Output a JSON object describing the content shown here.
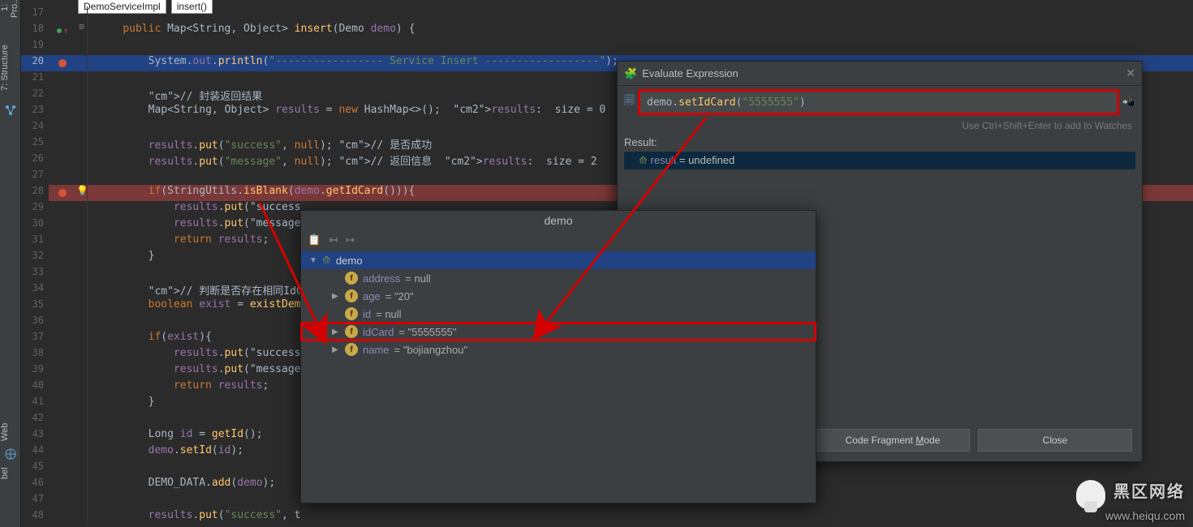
{
  "tabs": {
    "file": "DemoServiceImpl",
    "method": "insert()"
  },
  "left_sidebar": {
    "project": "1: Pro...",
    "structure": "7: Structure",
    "web": "Web",
    "bel": "bel"
  },
  "code": [
    {
      "n": 17,
      "t": ""
    },
    {
      "n": 18,
      "t": "    public Map<String, Object> insert(Demo demo) {",
      "marks": "green-up",
      "fold": "⊟"
    },
    {
      "n": 19,
      "t": ""
    },
    {
      "n": 20,
      "t": "        System.out.println(\"----------------- Service Insert ------------------\");",
      "hl": "blue",
      "marks": "red"
    },
    {
      "n": 21,
      "t": ""
    },
    {
      "n": 22,
      "t": "        // 封装返回结果"
    },
    {
      "n": 23,
      "t": "        Map<String, Object> results = new HashMap<>();  results:  size = 0"
    },
    {
      "n": 24,
      "t": ""
    },
    {
      "n": 25,
      "t": "        results.put(\"success\", null); // 是否成功"
    },
    {
      "n": 26,
      "t": "        results.put(\"message\", null); // 返回信息  results:  size = 2"
    },
    {
      "n": 27,
      "t": ""
    },
    {
      "n": 28,
      "t": "        if(StringUtils.isBlank(demo.getIdCard())){",
      "hl": "red",
      "marks": "red",
      "bulb": true
    },
    {
      "n": 29,
      "t": "            results.put(\"success"
    },
    {
      "n": 30,
      "t": "            results.put(\"message"
    },
    {
      "n": 31,
      "t": "            return results;"
    },
    {
      "n": 32,
      "t": "        }"
    },
    {
      "n": 33,
      "t": ""
    },
    {
      "n": 34,
      "t": "        // 判断是否存在相同IdCard"
    },
    {
      "n": 35,
      "t": "        boolean exist = existDem"
    },
    {
      "n": 36,
      "t": ""
    },
    {
      "n": 37,
      "t": "        if(exist){"
    },
    {
      "n": 38,
      "t": "            results.put(\"success"
    },
    {
      "n": 39,
      "t": "            results.put(\"message"
    },
    {
      "n": 40,
      "t": "            return results;"
    },
    {
      "n": 41,
      "t": "        }"
    },
    {
      "n": 42,
      "t": ""
    },
    {
      "n": 43,
      "t": "        Long id = getId();"
    },
    {
      "n": 44,
      "t": "        demo.setId(id);"
    },
    {
      "n": 45,
      "t": ""
    },
    {
      "n": 46,
      "t": "        DEMO_DATA.add(demo);"
    },
    {
      "n": 47,
      "t": ""
    },
    {
      "n": 48,
      "t": "        results.put(\"success\", t"
    }
  ],
  "eval": {
    "title": "Evaluate Expression",
    "expression_prefix": "demo.",
    "expression_method": "setIdCard",
    "expression_arg": "\"5555555\"",
    "hint": "Use Ctrl+Shift+Enter to add to Watches",
    "result_label": "Result:",
    "result_var": "result",
    "result_val": "undefined",
    "button_mode": "Code Fragment Mode",
    "button_close": "Close"
  },
  "inspect": {
    "title": "demo",
    "root": "demo",
    "fields": [
      {
        "name": "address",
        "display": "= null",
        "expand": ""
      },
      {
        "name": "age",
        "display": "= \"20\"",
        "expand": "▶"
      },
      {
        "name": "id",
        "display": "= null",
        "expand": ""
      },
      {
        "name": "idCard",
        "display": "= \"5555555\"",
        "expand": "▶",
        "boxed": true
      },
      {
        "name": "name",
        "display": "= \"bojiangzhou\"",
        "expand": "▶"
      }
    ]
  },
  "watermark": {
    "brand": "黑区网络",
    "url": "www.heiqu.com"
  }
}
